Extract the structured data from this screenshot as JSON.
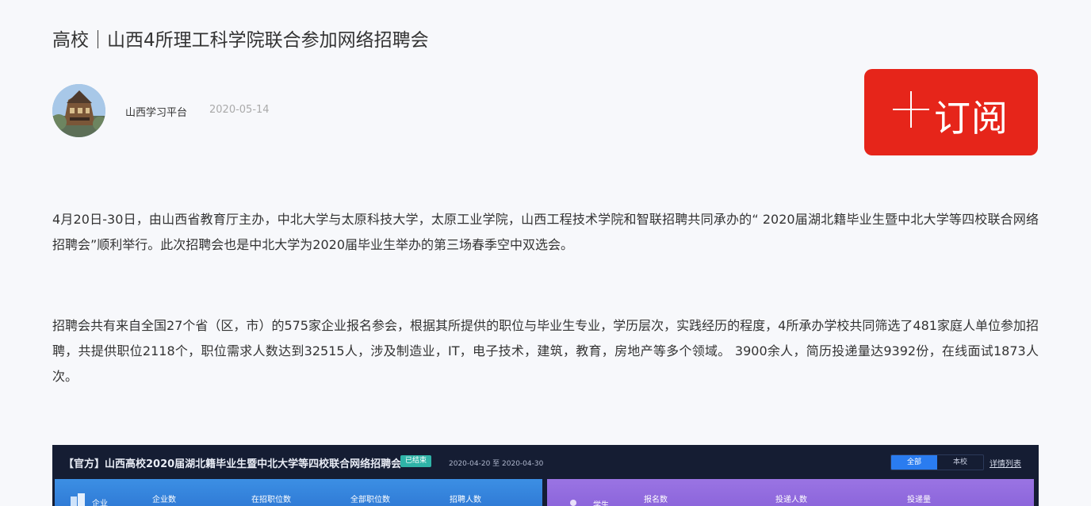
{
  "article": {
    "title": "高校｜山西4所理工科学院联合参加网络招聘会",
    "author": "山西学习平台",
    "date": "2020-05-14",
    "subscribe_label": "订阅",
    "paragraphs": [
      "4月20日-30日，由山西省教育厅主办，中北大学与太原科技大学，太原工业学院，山西工程技术学院和智联招聘共同承办的“ 2020届湖北籍毕业生暨中北大学等四校联合网络招聘会”顺利举行。此次招聘会也是中北大学为2020届毕业生举办的第三场春季空中双选会。",
      "招聘会共有来自全国27个省（区，市）的575家企业报名参会，根据其所提供的职位与毕业生专业，学历层次，实践经历的程度，4所承办学校共同筛选了481家庭人单位参加招聘，共提供职位2118个，职位需求人数达到32515人，涉及制造业，IT，电子技术，建筑，教育，房地产等多个领域。 3900余人，简历投递量达9392份，在线面试1873人次。"
    ]
  },
  "embed": {
    "title": "【官方】山西高校2020届湖北籍毕业生暨中北大学等四校联合网络招聘会",
    "status_badge": "已结束",
    "date_range": "2020-04-20 至 2020-04-30",
    "toggle": [
      "全部",
      "本校"
    ],
    "detail_link": "详情列表",
    "enterprise_panel": {
      "tag": "企业",
      "columns": [
        "企业数",
        "在招职位数",
        "全部职位数",
        "招聘人数"
      ]
    },
    "student_panel": {
      "tag": "学生",
      "columns": [
        "报名数",
        "投递人数",
        "投递量"
      ]
    }
  },
  "colors": {
    "subscribe": "#e6251a",
    "embed_bg": "#151d33",
    "panel_blue": "#3c8fe4",
    "panel_purple": "#9a74e3",
    "badge": "#2fb4a8"
  },
  "icons": {
    "subscribe": "plus-icon",
    "enterprise": "building-icon",
    "student": "user-icon"
  }
}
